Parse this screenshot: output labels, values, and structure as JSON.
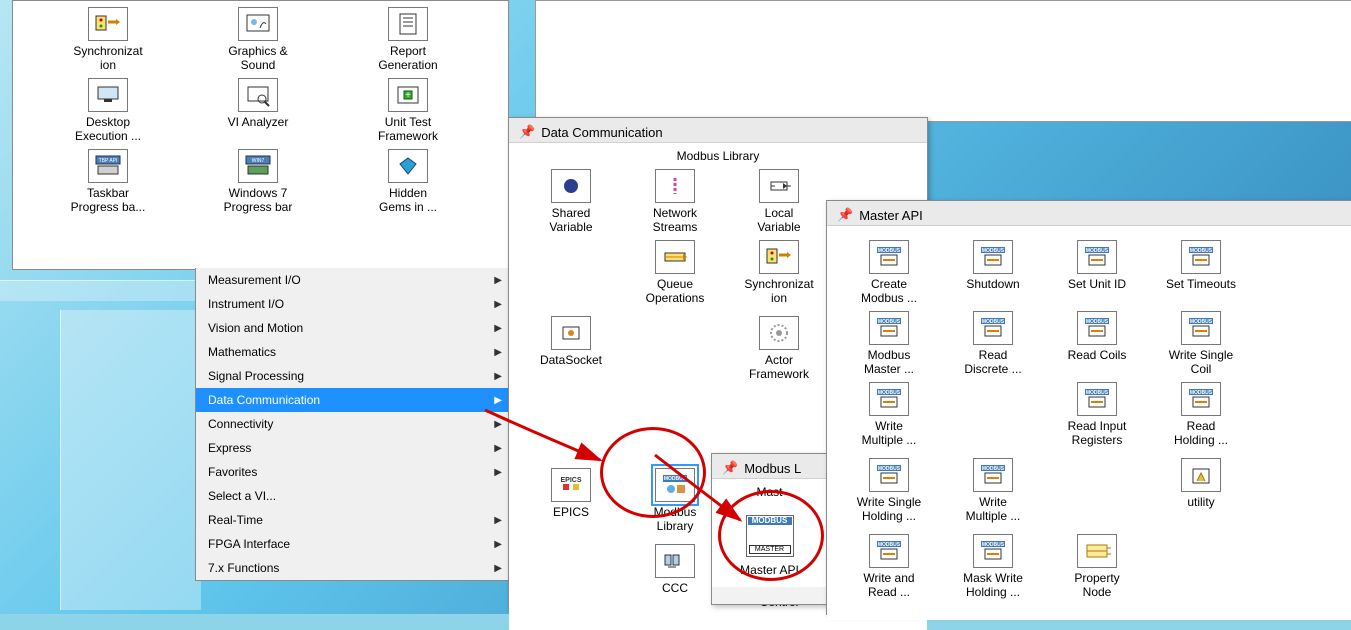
{
  "palette": {
    "row1": [
      {
        "label": "Synchronizat\nion"
      },
      {
        "label": "Graphics &\nSound"
      },
      {
        "label": "Report\nGeneration"
      }
    ],
    "row2": [
      {
        "label": "Desktop\nExecution ..."
      },
      {
        "label": "VI Analyzer"
      },
      {
        "label": "Unit Test\nFramework"
      }
    ],
    "row3": [
      {
        "label": "Taskbar\nProgress ba..."
      },
      {
        "label": "Windows 7\nProgress bar"
      },
      {
        "label": "Hidden\nGems in ..."
      }
    ]
  },
  "menu": [
    "Measurement I/O",
    "Instrument I/O",
    "Vision and Motion",
    "Mathematics",
    "Signal Processing",
    "Data Communication",
    "Connectivity",
    "Express",
    "Favorites",
    "Select a VI...",
    "Real-Time",
    "FPGA Interface",
    "7.x Functions"
  ],
  "menuSelectedIndex": 5,
  "datacomm": {
    "title": "Data Communication",
    "subtitle": "Modbus Library",
    "items": [
      {
        "label": "Shared\nVariable"
      },
      {
        "label": "Network\nStreams"
      },
      {
        "label": "Local\nVariable"
      },
      {
        "label": ""
      },
      {
        "label": "Queue\nOperations"
      },
      {
        "label": "Synchronizat\nion"
      },
      {
        "label": "DataSocket"
      },
      {
        "label": ""
      },
      {
        "label": "Actor\nFramework"
      },
      {
        "label": ""
      },
      {
        "label": ""
      },
      {
        "label": ""
      },
      {
        "label": "EPICS"
      },
      {
        "label": "Modbus\nLibrary",
        "hl": true
      },
      {
        "label": ""
      },
      {
        "label": ""
      },
      {
        "label": "CCC"
      },
      {
        "label": "Open Sound\nControl"
      }
    ]
  },
  "modbuslib": {
    "title": "Modbus L",
    "items": [
      {
        "label": "Mast"
      },
      {
        "label": "Master API",
        "hl": true
      }
    ]
  },
  "masterapi": {
    "title": "Master API",
    "items": [
      {
        "label": "Create\nModbus ..."
      },
      {
        "label": "Shutdown"
      },
      {
        "label": "Set Unit ID"
      },
      {
        "label": "Set Timeouts"
      },
      {
        "label": "Modbus\nMaster ..."
      },
      {
        "label": "Read\nDiscrete ..."
      },
      {
        "label": "Read Coils"
      },
      {
        "label": "Write Single\nCoil"
      },
      {
        "label": "Write\nMultiple ..."
      },
      {
        "label": ""
      },
      {
        "label": "Read Input\nRegisters"
      },
      {
        "label": "Read\nHolding ..."
      },
      {
        "label": "Write Single\nHolding ..."
      },
      {
        "label": "Write\nMultiple ..."
      },
      {
        "label": ""
      },
      {
        "label": "utility"
      },
      {
        "label": "Write and\nRead ..."
      },
      {
        "label": "Mask Write\nHolding ..."
      },
      {
        "label": "Property\nNode"
      },
      {
        "label": ""
      }
    ]
  }
}
